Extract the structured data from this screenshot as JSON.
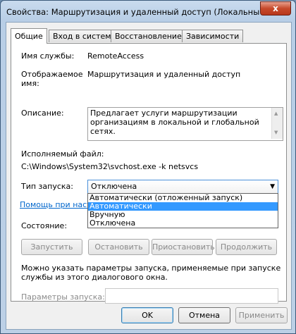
{
  "window": {
    "title": "Свойства: Маршрутизация и удаленный доступ (Локальный ко...",
    "close_glyph": "x"
  },
  "tabs": [
    "Общие",
    "Вход в систему",
    "Восстановление",
    "Зависимости"
  ],
  "general": {
    "service_name_label": "Имя службы:",
    "service_name_value": "RemoteAccess",
    "display_name_label_line1": "Отображаемое",
    "display_name_label_line2": "имя:",
    "display_name_value": "Маршрутизация и удаленный доступ",
    "description_label": "Описание:",
    "description_value": "Предлагает услуги маршрутизации организациям в локальной и глобальной сетях.",
    "exe_label": "Исполняемый файл:",
    "exe_value": "C:\\Windows\\System32\\svchost.exe -k netsvcs",
    "startup_type_label": "Тип запуска:",
    "startup_type_selected": "Отключена",
    "startup_options": [
      "Автоматически (отложенный запуск)",
      "Автоматически",
      "Вручную",
      "Отключена"
    ],
    "highlighted_option_index": 1,
    "help_link": "Помощь при наст",
    "status_label": "Состояние:",
    "buttons": {
      "start": "Запустить",
      "stop": "Остановить",
      "pause": "Приостановить",
      "resume": "Продолжить"
    },
    "hint_line1": "Можно указать параметры запуска, применяемые при запуске",
    "hint_line2": "службы из этого диалогового окна.",
    "params_label": "Параметры запуска:",
    "params_value": ""
  },
  "footer": {
    "ok": "OK",
    "cancel": "Отмена",
    "apply": "Применить"
  }
}
